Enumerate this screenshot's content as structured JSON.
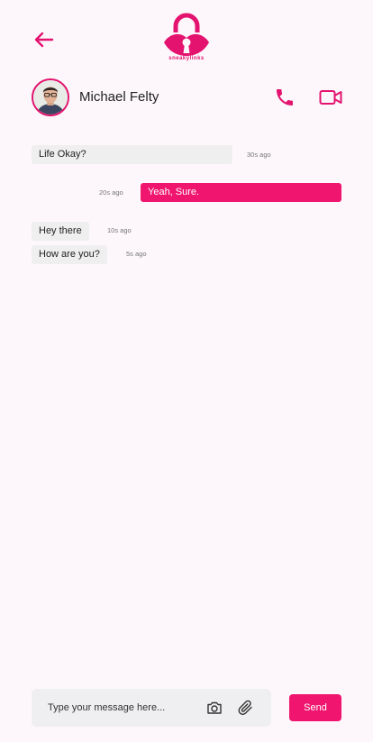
{
  "brand": {
    "name": "sneakylinks",
    "accent": "#e3136f",
    "bubble_out": "#f0156e"
  },
  "header": {
    "back_icon": "arrow-left-icon",
    "contact_name": "Michael Felty",
    "call_icon": "phone-icon",
    "video_icon": "video-camera-icon"
  },
  "messages": [
    {
      "text": "Life Okay?",
      "time": "30s ago",
      "direction": "incoming"
    },
    {
      "text": "Yeah, Sure.",
      "time": "20s ago",
      "direction": "outgoing"
    },
    {
      "text": "Hey there",
      "time": "10s ago",
      "direction": "incoming"
    },
    {
      "text": "How are you?",
      "time": "5s ago",
      "direction": "incoming"
    }
  ],
  "composer": {
    "placeholder": "Type your message here...",
    "camera_icon": "camera-icon",
    "attach_icon": "paperclip-icon",
    "send_label": "Send"
  }
}
